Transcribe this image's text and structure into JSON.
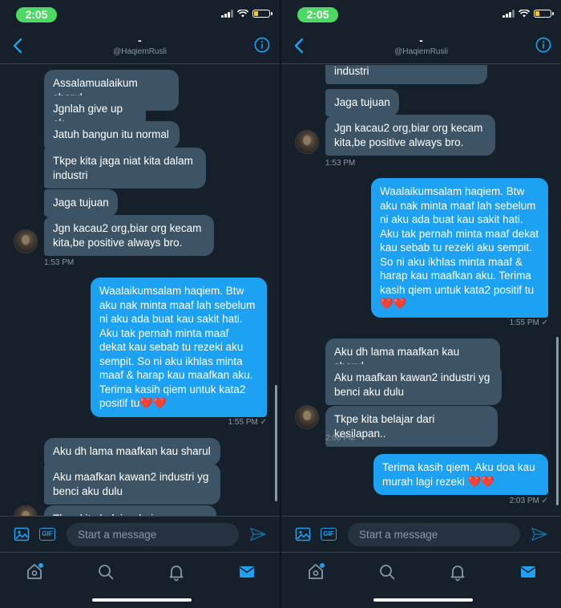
{
  "status_bar": {
    "time": "2:05"
  },
  "header": {
    "name": "-",
    "handle": "@HaqiemRusli"
  },
  "left_pane": {
    "received_1": [
      "Assalamualaikum sharul",
      "Jgnlah give up ok",
      "Jatuh bangun itu normal",
      "Tkpe kita jaga niat kita dalam industri",
      "Jaga tujuan",
      "Jgn kacau2 org,biar org kecam kita,be positive always bro."
    ],
    "received_1_time": "1:53 PM",
    "sent_1": "Waalaikumsalam haqiem. Btw aku nak minta maaf lah sebelum ni aku ada buat kau sakit hati. Aku tak pernah minta maaf dekat kau sebab tu rezeki aku sempit. So ni aku ikhlas minta maaf & harap kau maafkan aku. Terima kasih qiem untuk kata2 positif tu",
    "sent_1_emoji": "❤️❤️",
    "sent_1_time": "1:55 PM ✓",
    "received_2": [
      "Aku dh lama maafkan kau sharul",
      "Aku maafkan kawan2 industri yg benci aku dulu",
      "Tkpe kita belajar dari kesilapan.."
    ]
  },
  "right_pane": {
    "received_1": [
      "Tkpe kita jaga niat kita dalam industri",
      "Jaga tujuan",
      "Jgn kacau2 org,biar org kecam kita,be positive always bro."
    ],
    "received_1_time": "1:53 PM",
    "sent_1": "Waalaikumsalam haqiem. Btw aku nak minta maaf lah sebelum ni aku ada buat kau sakit hati. Aku tak pernah minta maaf dekat kau sebab tu rezeki aku sempit. So ni aku ikhlas minta maaf & harap kau maafkan aku. Terima kasih qiem untuk kata2 positif tu",
    "sent_1_emoji": "❤️❤️",
    "sent_1_time": "1:55 PM ✓",
    "received_2": [
      "Aku dh lama maafkan kau sharul",
      "Aku maafkan kawan2 industri yg benci aku dulu",
      "Tkpe kita belajar dari kesilapan.."
    ],
    "received_2_time": "2:00 PM",
    "sent_2": "Terima kasih qiem. Aku doa kau murah lagi rezeki",
    "sent_2_emoji": "❤️❤️",
    "sent_2_time": "2:03 PM ✓"
  },
  "composer": {
    "placeholder": "Start a message",
    "gif_label": "GIF"
  },
  "tabs": [
    "home-icon",
    "search-icon",
    "notifications-icon",
    "messages-icon"
  ],
  "colors": {
    "background": "#15202b",
    "accent": "#1da1f2",
    "received_bubble": "#3d5466",
    "status_pill": "#4cd964"
  }
}
